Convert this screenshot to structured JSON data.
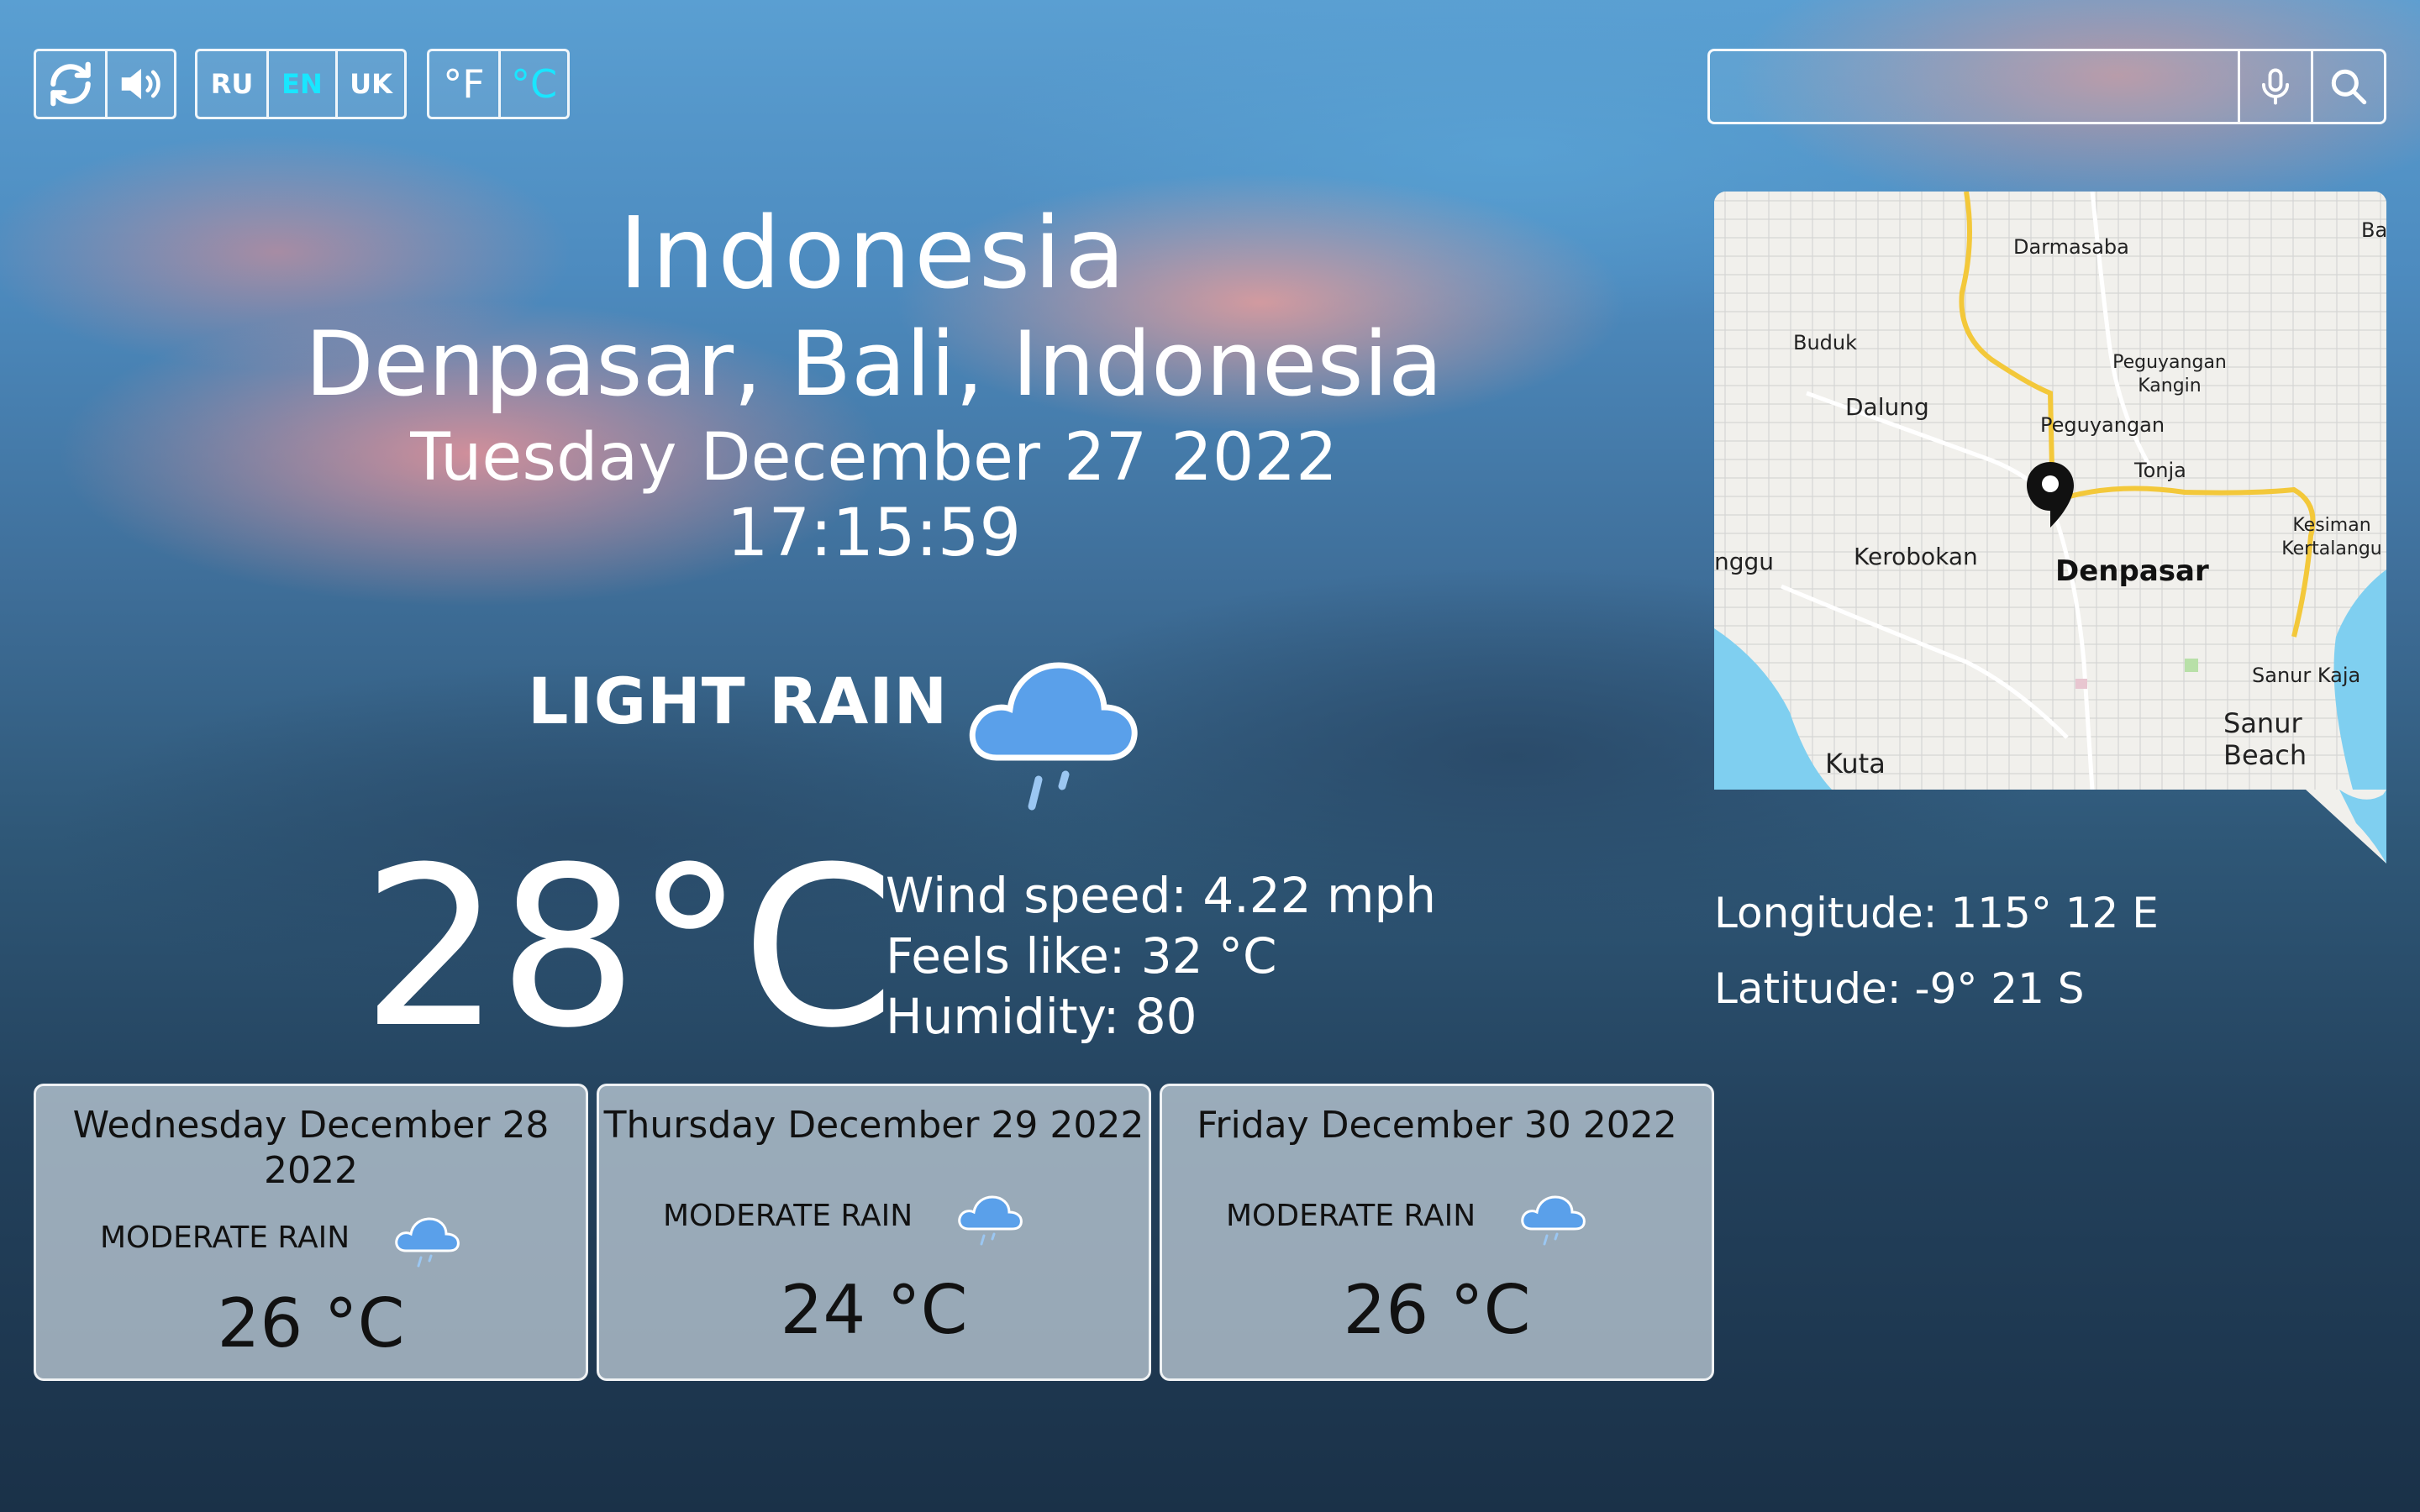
{
  "controls": {
    "refresh_icon": "refresh-icon",
    "sound_icon": "speaker-icon",
    "languages": [
      "RU",
      "EN",
      "UK"
    ],
    "active_language": "EN",
    "units": [
      "°F",
      "°C"
    ],
    "active_unit": "°C",
    "accent_color": "#19e6ff"
  },
  "search": {
    "placeholder": "",
    "value": ""
  },
  "location": {
    "country": "Indonesia",
    "city": "Denpasar, Bali, Indonesia",
    "weekday": "Tuesday",
    "month": "December",
    "day": "27",
    "year": "2022",
    "time": "17:15:59"
  },
  "current": {
    "condition": "LIGHT RAIN",
    "temperature": "28°C",
    "wind": "Wind speed: 4.22 mph",
    "feels_like": "Feels like: 32 °C",
    "humidity": "Humidity: 80"
  },
  "map": {
    "labels": [
      "Darmasaba",
      "Buduk",
      "Dalung",
      "Peguyangan Kangin",
      "Peguyangan",
      "Tonja",
      "Kesiman Kertalangu",
      "Kerobokan",
      "Denpasar",
      "nggu",
      "Sanur Kaja",
      "Sanur Beach",
      "Kuta",
      "Ba"
    ]
  },
  "coordinates": {
    "longitude": "Longitude: 115° 12 E",
    "latitude": "Latitude: -9° 21 S"
  },
  "forecast": [
    {
      "date_line1": "Wednesday  December  28",
      "date_line2": "2022",
      "condition": "MODERATE RAIN",
      "temp": "26 °C"
    },
    {
      "date_line1": "Thursday  December  29  2022",
      "date_line2": "",
      "condition": "MODERATE RAIN",
      "temp": "24 °C"
    },
    {
      "date_line1": "Friday  December  30  2022",
      "date_line2": "",
      "condition": "MODERATE RAIN",
      "temp": "26 °C"
    }
  ]
}
